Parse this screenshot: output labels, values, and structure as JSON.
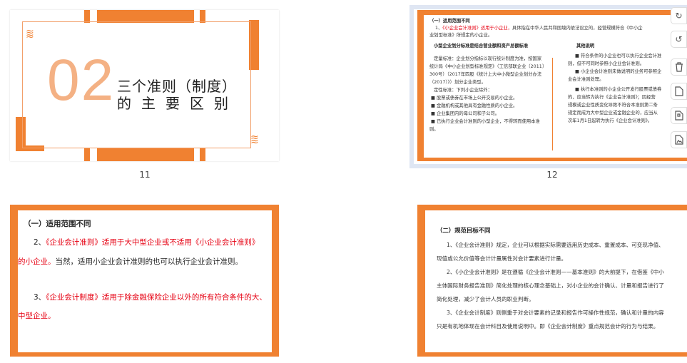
{
  "slides": [
    {
      "number": "11",
      "big_number": "02",
      "title_line1": "三个准则（制度）",
      "title_line2": "的主要区别"
    },
    {
      "number": "12",
      "heading": "（一）适用范围不同",
      "intro_prefix": "1、",
      "intro_red": "《小企业会计准则》适用于小企业，",
      "intro_rest": "具体指在中华人民共和国境内依法设立的，经营规模符合《中小企",
      "intro_line2": "业划型标准》所规定的小企业。",
      "left_heading": "小型企业划分标准是结合营业额和资产总额标准",
      "left_lines": [
        "定量标准：企业划分指标以现行统计制度为准，按国家",
        "统计局《中小企业划型标准规定》（工信部联企业〔2011〕",
        "300号）（2017年四股《统计上大中小微型企业划分办法",
        "（2017）》）划分企业类型。",
        "定性标准：下列小企业除外：",
        "■ 股票或债券在市场上公开交易的小企业。",
        "■ 金融机构或其他具有金融性质的小企业。",
        "■ 企业集团内的母公司和子公司。",
        "■ 已执行企业会计准则的小型企业，不得转而使用本准",
        "则。"
      ],
      "right_heading": "其他说明",
      "right_lines": [
        "■ 符合条件的小企业也可以执行企业会计准",
        "则，但不可同时参照小企业会计准则。",
        "■ 小企业会计准则未做说明的业务可参照企",
        "业会计准则处理。",
        "■ 执行本准则的小企业公开发行股票或债券",
        "的，应当转为执行《企业会计准则》；因经营",
        "规模或企业性质变化导致不符合本准则第二条",
        "规定而成为大中型企业或金融企业的，应当从",
        "次年1月1日起转为执行《企业会计准则》。"
      ]
    },
    {
      "heading": "（一）适用范围不同",
      "item2_prefix": "2、",
      "item2_red": "《企业会计准则》适用于大中型企业或不适用《小企业会计准则》",
      "item2_red2": "的小企业。",
      "item2_rest": "当然，适用小企业会计准则的也可以执行企业会计准则。",
      "item3_prefix": "3、",
      "item3_red": "《企业会计制度》适用于除金融保险企业以外的所有符合条件的大、",
      "item3_red2": "中型企业。"
    },
    {
      "heading": "（二）规范目标不同",
      "lines": [
        "1、《企业会计准则》规定，企业可以根据实际需要选用历史成本、重置成本、可变现净值、",
        "现值或公允价值等会计计量属性对会计要素进行计量。",
        "2、《小企业会计准则》是在遵循《企业会计准则——基本准则》的大前提下，在借鉴《中小",
        "主体国际财务报告准则》简化处理的核心理念基础上，对小企业的会计确认、计量和报告进行了",
        "简化处理，减少了会计人员的职业判断。",
        "3、《企业会计制度》则侧重于对会计要素的记录和报告作可操作性规范，确认和计量的内容",
        "只是有机地体现在会计科目及使用说明中。即《企业会计制度》重点规范会计的行为与结果。"
      ]
    }
  ],
  "toolbar": {
    "items": [
      "redo-icon",
      "undo-icon",
      "delete-icon",
      "new-slide-icon",
      "replace-icon",
      "insert-image-icon"
    ]
  }
}
